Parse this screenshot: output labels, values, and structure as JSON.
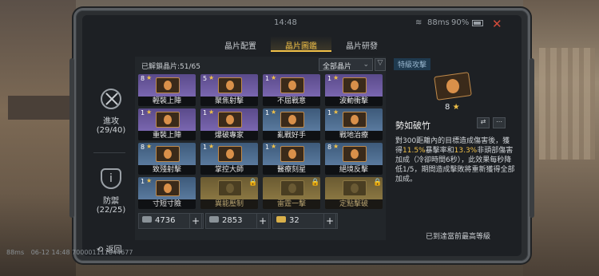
{
  "status": {
    "time": "14:48",
    "ping": "88ms",
    "battery": "90%"
  },
  "tabs": [
    {
      "label": "晶片配置"
    },
    {
      "label": "晶片圖鑑"
    },
    {
      "label": "晶片研發"
    }
  ],
  "sidebar": {
    "attack_label": "進攻",
    "attack_count": "(29/40)",
    "defense_label": "防禦",
    "defense_count": "(22/25)"
  },
  "grid": {
    "unlocked": "已解鎖晶片:51/65",
    "filter_label": "全部晶片",
    "cards": [
      {
        "level": "8",
        "name": "輕裝上陣",
        "color": "purple"
      },
      {
        "level": "5",
        "name": "聚焦射擊",
        "color": "purple"
      },
      {
        "level": "1",
        "name": "不屈戰意",
        "color": "purple"
      },
      {
        "level": "1",
        "name": "波動衝擊",
        "color": "purple"
      },
      {
        "level": "1",
        "name": "重裝上陣",
        "color": "purple"
      },
      {
        "level": "1",
        "name": "爆破專家",
        "color": "purple"
      },
      {
        "level": "1",
        "name": "亂戰好手",
        "color": "blue"
      },
      {
        "level": "1",
        "name": "戰地治療",
        "color": "blue"
      },
      {
        "level": "8",
        "name": "致殘射擊",
        "color": "blue"
      },
      {
        "level": "1",
        "name": "掌控大師",
        "color": "blue"
      },
      {
        "level": "1",
        "name": "醫療刻星",
        "color": "blue"
      },
      {
        "level": "8",
        "name": "絕境反擊",
        "color": "blue"
      },
      {
        "level": "1",
        "name": "寸短寸險",
        "color": "blue"
      },
      {
        "level": "",
        "name": "異能壓制",
        "color": "gold"
      },
      {
        "level": "",
        "name": "雷霆一擊",
        "color": "gold"
      },
      {
        "level": "",
        "name": "定點擊破",
        "color": "gold"
      }
    ]
  },
  "resources": [
    {
      "value": "4736",
      "icon": "chip-scrap-icon"
    },
    {
      "value": "2853",
      "icon": "alloy-icon"
    },
    {
      "value": "32",
      "icon": "gold-token-icon"
    }
  ],
  "detail": {
    "tag": "特級攻擊",
    "rank": "8",
    "title": "勢如破竹",
    "desc_pre": "對300距離內的目標造成傷害後，獲得",
    "desc_h1": "11.5%",
    "desc_mid1": "暴擊率和",
    "desc_h2": "13.3%",
    "desc_post": "非頭部傷害加成（冷卻時間6秒），此效果每秒降低1/5，期間造成擊敗將重新獲得全部加成。",
    "max_level": "已到達當前最高等級"
  },
  "footer": {
    "back": "返回",
    "ping": "88ms",
    "build": "06-12 14:48 700001111044677"
  }
}
